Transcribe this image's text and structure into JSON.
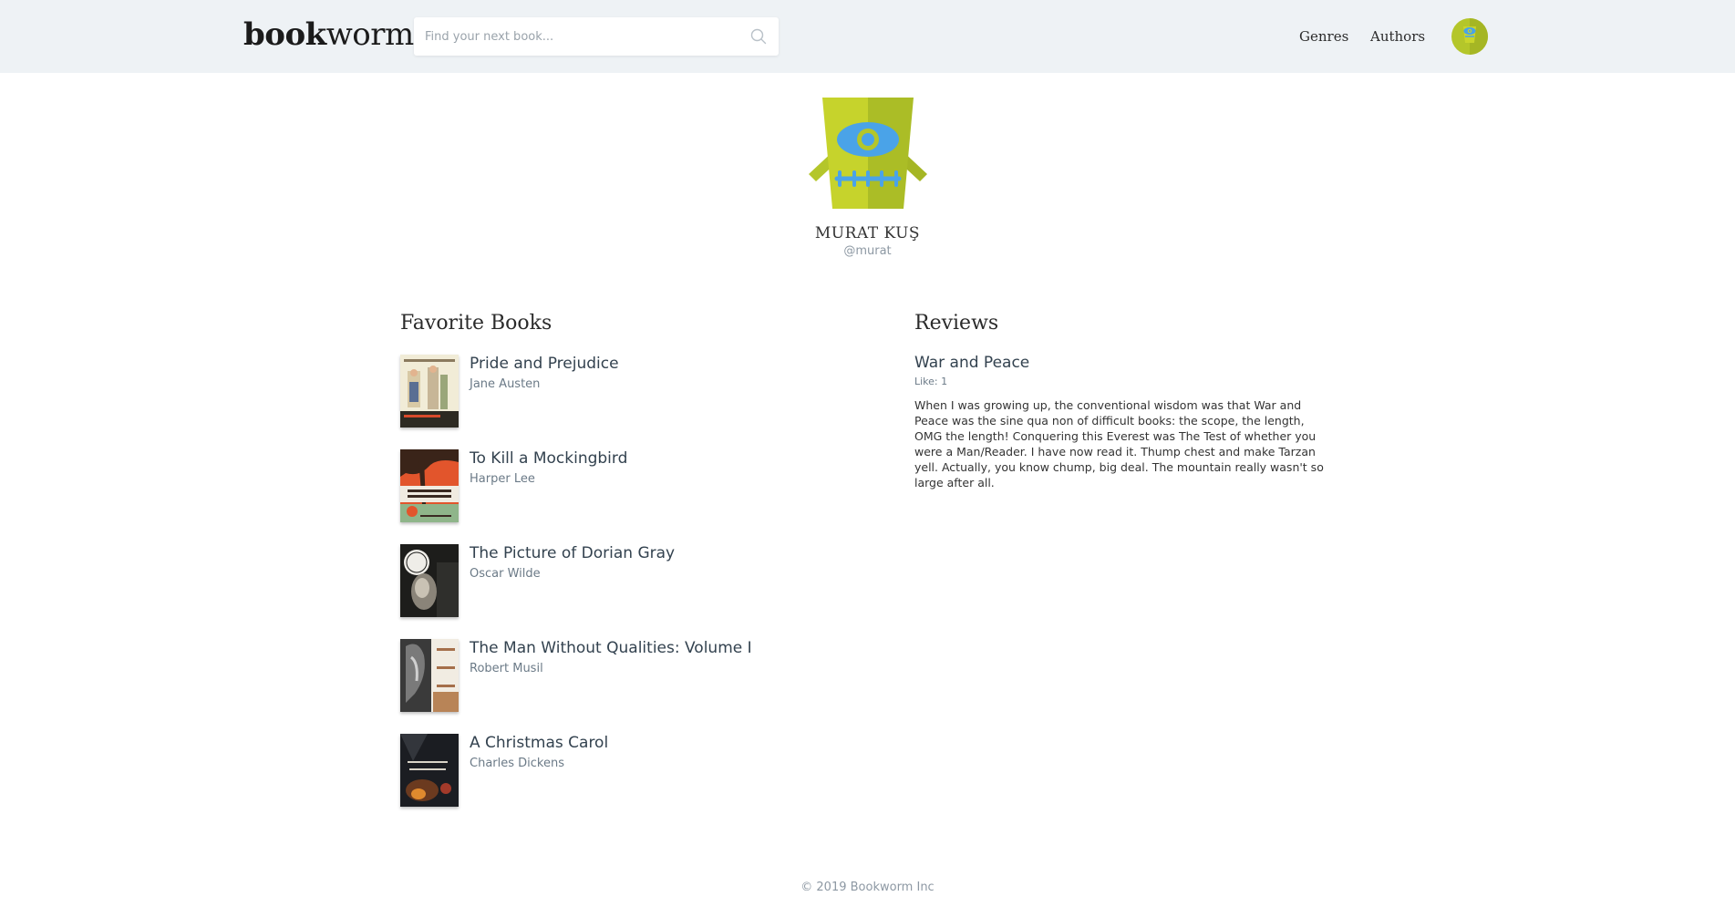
{
  "header": {
    "logo_bold": "book",
    "logo_light": "worm",
    "search_placeholder": "Find your next book...",
    "nav": {
      "genres": "Genres",
      "authors": "Authors"
    }
  },
  "profile": {
    "name": "MURAT KUŞ",
    "handle": "@murat"
  },
  "favorites": {
    "title": "Favorite Books",
    "books": [
      {
        "title": "Pride and Prejudice",
        "author": "Jane Austen"
      },
      {
        "title": "To Kill a Mockingbird",
        "author": "Harper Lee"
      },
      {
        "title": "The Picture of Dorian Gray",
        "author": "Oscar Wilde"
      },
      {
        "title": "The Man Without Qualities: Volume I",
        "author": "Robert Musil"
      },
      {
        "title": "A Christmas Carol",
        "author": "Charles Dickens"
      }
    ]
  },
  "reviews": {
    "title": "Reviews",
    "items": [
      {
        "book": "War and Peace",
        "likes": "Like: 1",
        "text": "When I was growing up, the conventional wisdom was that War and Peace was the sine qua non of difficult books: the scope, the length, OMG the length! Conquering this Everest was The Test of whether you were a Man/Reader. I have now read it. Thump chest and make Tarzan yell. Actually, you know chump, big deal. The mountain really wasn't so large after all."
      }
    ]
  },
  "footer": {
    "copyright": "© 2019 Bookworm Inc"
  },
  "colors": {
    "header_bg": "#eef2f5",
    "avatar_green": "#b4c62a",
    "avatar_blue": "#4aa3e8",
    "link_text": "#33424f",
    "muted_text": "#6b7a87"
  }
}
